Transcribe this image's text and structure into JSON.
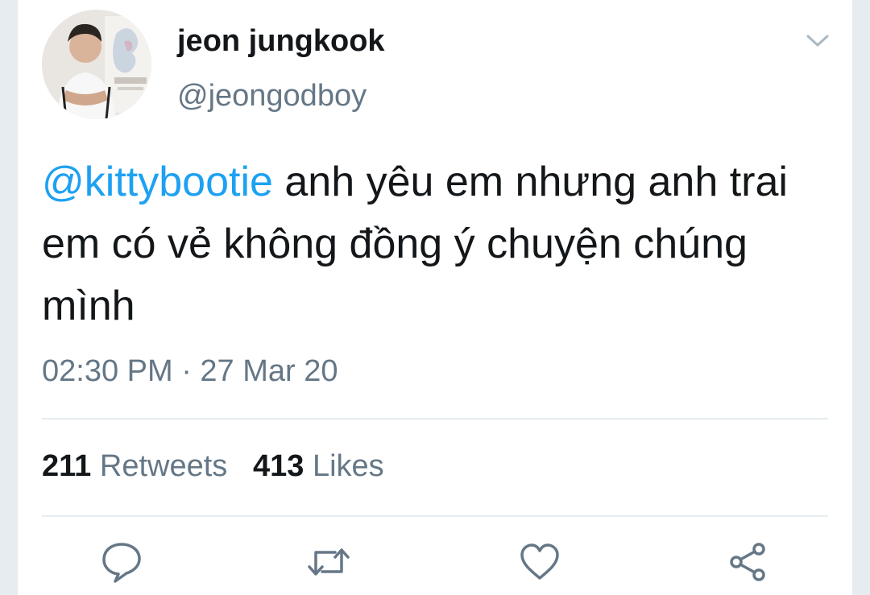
{
  "tweet": {
    "author_name": "jeon jungkook",
    "author_handle": "@jeongodboy",
    "mention": "@kittybootie",
    "text": " anh yêu em nhưng anh trai em có vẻ không đồng ý chuyện chúng mình",
    "timestamp": "02:30 PM · 27 Mar 20"
  },
  "stats": {
    "retweets_count": "211",
    "retweets_label": "Retweets",
    "likes_count": "413",
    "likes_label": "Likes"
  },
  "icons": {
    "more": "chevron-down-icon",
    "reply": "reply-icon",
    "retweet": "retweet-icon",
    "like": "heart-icon",
    "share": "share-icon"
  },
  "colors": {
    "accent": "#1da1f2",
    "text": "#14171a",
    "secondary": "#657786",
    "divider": "#e6ecf0"
  }
}
